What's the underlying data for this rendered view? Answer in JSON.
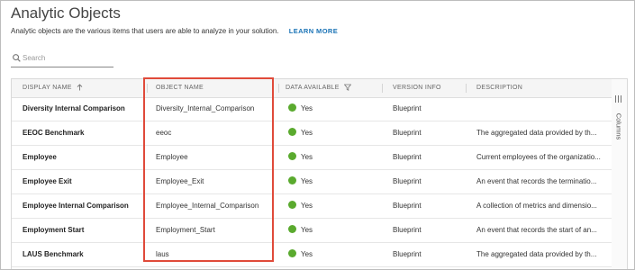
{
  "header": {
    "title": "Analytic Objects",
    "description": "Analytic objects are the various items that users are able to analyze in your solution.",
    "learn_more": "LEARN MORE"
  },
  "search": {
    "placeholder": "Search"
  },
  "columns_label": "Columns",
  "table": {
    "columns": [
      "DISPLAY NAME",
      "OBJECT NAME",
      "DATA AVAILABLE",
      "VERSION INFO",
      "DESCRIPTION"
    ],
    "rows": [
      {
        "display": "Diversity Internal Comparison",
        "object": "Diversity_Internal_Comparison",
        "available": "Yes",
        "version": "Blueprint",
        "description": ""
      },
      {
        "display": "EEOC Benchmark",
        "object": "eeoc",
        "available": "Yes",
        "version": "Blueprint",
        "description": "The aggregated data provided by th..."
      },
      {
        "display": "Employee",
        "object": "Employee",
        "available": "Yes",
        "version": "Blueprint",
        "description": "Current employees of the organizatio..."
      },
      {
        "display": "Employee Exit",
        "object": "Employee_Exit",
        "available": "Yes",
        "version": "Blueprint",
        "description": "An event that records the terminatio..."
      },
      {
        "display": "Employee Internal Comparison",
        "object": "Employee_Internal_Comparison",
        "available": "Yes",
        "version": "Blueprint",
        "description": "A collection of metrics and dimensio..."
      },
      {
        "display": "Employment Start",
        "object": "Employment_Start",
        "available": "Yes",
        "version": "Blueprint",
        "description": "An event that records the start of an..."
      },
      {
        "display": "LAUS Benchmark",
        "object": "laus",
        "available": "Yes",
        "version": "Blueprint",
        "description": "The aggregated data provided by th..."
      }
    ]
  },
  "colors": {
    "available_dot": "#5aaa2e",
    "highlight_border": "#e04a3a",
    "link": "#1a73b6"
  },
  "icons": {
    "search": "search-icon",
    "sort": "sort-ascending-icon",
    "filter": "filter-icon",
    "columns": "columns-icon"
  }
}
